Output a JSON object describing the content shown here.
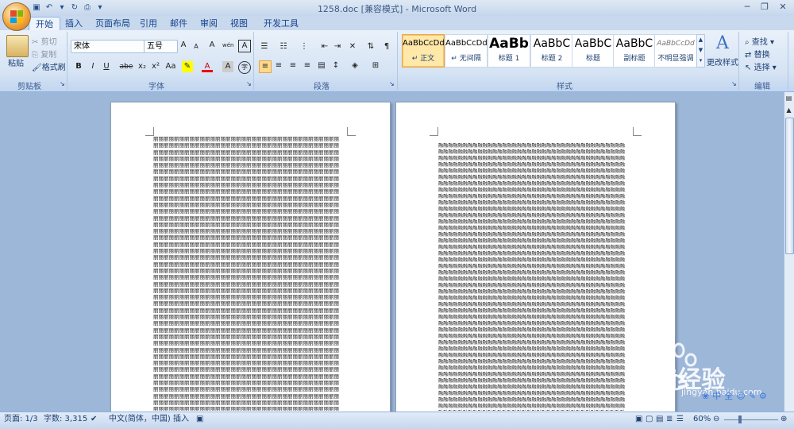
{
  "window": {
    "title": "1258.doc [兼容模式] - Microsoft Word"
  },
  "tabs": [
    "开始",
    "插入",
    "页面布局",
    "引用",
    "邮件",
    "审阅",
    "视图",
    "开发工具"
  ],
  "clipboard": {
    "paste": "粘贴",
    "cut": "剪切",
    "copy": "复制",
    "format_painter": "格式刷",
    "label": "剪贴板"
  },
  "font": {
    "name": "宋体",
    "size": "五号",
    "label": "字体",
    "bold": "B",
    "italic": "I",
    "underline": "U",
    "strike": "abe",
    "sub": "x₂",
    "sup": "x²",
    "change_case": "Aa",
    "font_color": "A",
    "grow": "A",
    "shrink": "A",
    "clear": "A",
    "phonetic": "wén",
    "char_border": "A",
    "enclosed": "字"
  },
  "paragraph": {
    "label": "段落"
  },
  "styles": {
    "label": "样式",
    "items": [
      {
        "preview": "AaBbCcDd",
        "name": "↵ 正文"
      },
      {
        "preview": "AaBbCcDd",
        "name": "↵ 无间隔"
      },
      {
        "preview": "AaBb",
        "name": "标题 1"
      },
      {
        "preview": "AaBbC",
        "name": "标题 2"
      },
      {
        "preview": "AaBbC",
        "name": "标题"
      },
      {
        "preview": "AaBbC",
        "name": "副标题"
      },
      {
        "preview": "AaBbCcDd",
        "name": "不明显强调"
      }
    ],
    "change_styles": "更改样式"
  },
  "editing": {
    "find": "查找",
    "replace": "替换",
    "select": "选择",
    "label": "编辑"
  },
  "pages": {
    "left_char": "丽",
    "right_char": "融"
  },
  "statusbar": {
    "page": "页面: 1/3",
    "words": "字数: 3,315",
    "language": "中文(简体，中国)",
    "mode": "插入",
    "zoom": "60%"
  },
  "watermark": {
    "brand": "Bai经验",
    "url": "jingyan.baidu.com",
    "toolbar": [
      "中",
      "全",
      "☺",
      "✎",
      "⚙"
    ]
  },
  "colors": {
    "accent": "#15428b",
    "ribbon": "#d5e3f4",
    "doc_bg": "#9db7d9"
  }
}
